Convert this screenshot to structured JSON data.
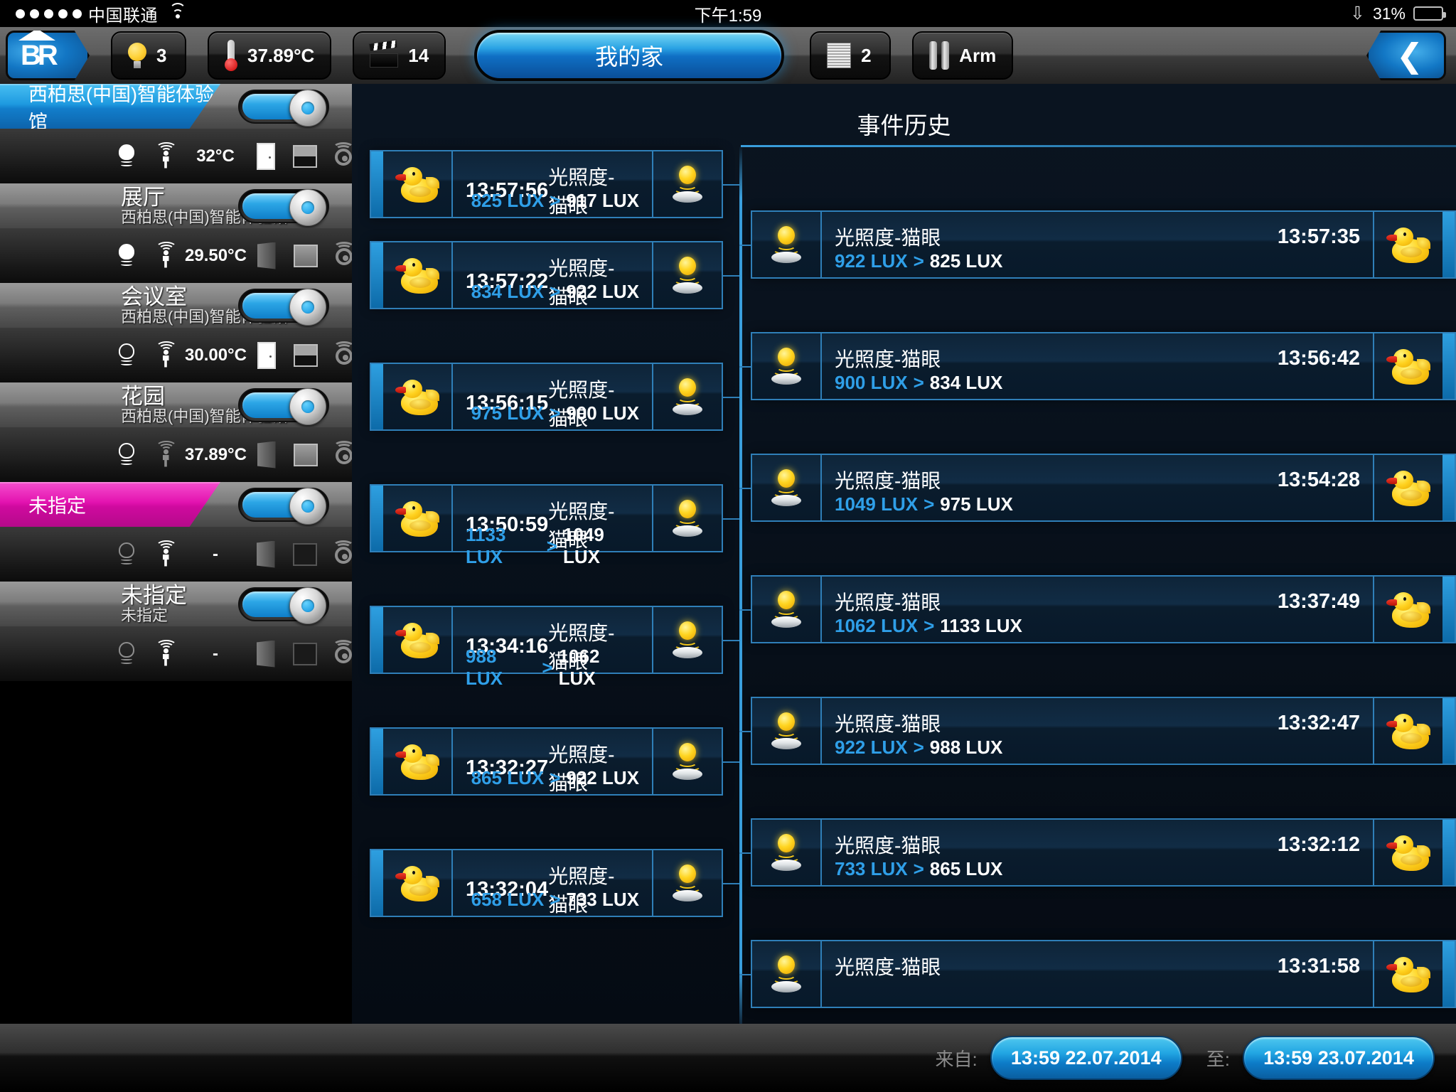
{
  "statusbar": {
    "carrier": "中国联通",
    "time": "下午1:59",
    "battery_percent": "31%",
    "wifi_icon": "wifi-icon",
    "bluetooth_icon": "bluetooth-icon",
    "battery_icon": "battery-icon",
    "signal_dots": 5
  },
  "toolbar": {
    "home_logo": "home-logo-icon",
    "lights": {
      "icon": "light-bulb-icon",
      "count": "3"
    },
    "temperature": {
      "icon": "thermometer-icon",
      "value": "37.89°C"
    },
    "scenes": {
      "icon": "clapperboard-icon",
      "count": "14"
    },
    "blinds": {
      "icon": "blind-icon",
      "count": "2"
    },
    "security": {
      "icon": "arm-icon",
      "label": "Arm"
    },
    "title": "我的家",
    "back_icon": "chevron-left-icon"
  },
  "sidebar": {
    "rooms": [
      {
        "name": "西柏思(中国)智能体验馆",
        "parent": "",
        "accent": "blue",
        "toggle_on": true,
        "thumb": "none",
        "light_state": "on",
        "motion_state": "on",
        "temperature": "32°C",
        "door_state": "closed",
        "blind_state": "half",
        "siren_state": "off"
      },
      {
        "name": "展厅",
        "parent": "西柏思(中国)智能体验馆",
        "accent": "blue",
        "toggle_on": true,
        "thumb": "ball-chair-icon",
        "light_state": "on",
        "motion_state": "on",
        "temperature": "29.50°C",
        "door_state": "open",
        "blind_state": "full",
        "siren_state": "off"
      },
      {
        "name": "会议室",
        "parent": "西柏思(中国)智能体验馆",
        "accent": "blue",
        "toggle_on": true,
        "thumb": "dining-table-icon",
        "light_state": "off",
        "motion_state": "on",
        "temperature": "30.00°C",
        "door_state": "closed",
        "blind_state": "half",
        "siren_state": "off"
      },
      {
        "name": "花园",
        "parent": "西柏思(中国)智能体验馆",
        "accent": "blue",
        "toggle_on": true,
        "thumb": "rubber-duck-icon",
        "light_state": "off",
        "motion_state": "dim",
        "temperature": "37.89°C",
        "door_state": "open",
        "blind_state": "full",
        "siren_state": "off"
      },
      {
        "name": "未指定",
        "parent": "",
        "accent": "pink",
        "toggle_on": true,
        "thumb": "none",
        "light_state": "off",
        "motion_state": "on",
        "temperature": "-",
        "door_state": "open",
        "blind_state": "off",
        "siren_state": "off"
      },
      {
        "name": "未指定",
        "parent": "未指定",
        "accent": "pink",
        "toggle_on": true,
        "thumb": "abc-blocks-icon",
        "light_state": "off",
        "motion_state": "on",
        "temperature": "-",
        "door_state": "open",
        "blind_state": "off",
        "siren_state": "off"
      }
    ]
  },
  "history": {
    "title": "事件历史",
    "device_icon": "rubber-duck-icon",
    "sensor_icon": "light-sensor-icon",
    "events_left": [
      {
        "time": "13:57:56",
        "name": "光照度-猫眼",
        "from": "825 LUX",
        "arrow": ">",
        "to": "917 LUX"
      },
      {
        "time": "13:57:22",
        "name": "光照度-猫眼",
        "from": "834 LUX",
        "arrow": ">",
        "to": "922 LUX"
      },
      {
        "time": "13:56:15",
        "name": "光照度-猫眼",
        "from": "975 LUX",
        "arrow": ">",
        "to": "900 LUX"
      },
      {
        "time": "13:50:59",
        "name": "光照度-猫眼",
        "from": "1133 LUX",
        "arrow": ">",
        "to": "1049 LUX"
      },
      {
        "time": "13:34:16",
        "name": "光照度-猫眼",
        "from": "988 LUX",
        "arrow": ">",
        "to": "1062 LUX"
      },
      {
        "time": "13:32:27",
        "name": "光照度-猫眼",
        "from": "865 LUX",
        "arrow": ">",
        "to": "922 LUX"
      },
      {
        "time": "13:32:04",
        "name": "光照度-猫眼",
        "from": "658 LUX",
        "arrow": ">",
        "to": "733 LUX"
      }
    ],
    "events_right": [
      {
        "name": "光照度-猫眼",
        "time": "13:57:35",
        "from": "922 LUX",
        "arrow": ">",
        "to": "825 LUX"
      },
      {
        "name": "光照度-猫眼",
        "time": "13:56:42",
        "from": "900 LUX",
        "arrow": ">",
        "to": "834 LUX"
      },
      {
        "name": "光照度-猫眼",
        "time": "13:54:28",
        "from": "1049 LUX",
        "arrow": ">",
        "to": "975 LUX"
      },
      {
        "name": "光照度-猫眼",
        "time": "13:37:49",
        "from": "1062 LUX",
        "arrow": ">",
        "to": "1133 LUX"
      },
      {
        "name": "光照度-猫眼",
        "time": "13:32:47",
        "from": "922 LUX",
        "arrow": ">",
        "to": "988 LUX"
      },
      {
        "name": "光照度-猫眼",
        "time": "13:32:12",
        "from": "733 LUX",
        "arrow": ">",
        "to": "865 LUX"
      },
      {
        "name": "光照度-猫眼",
        "time": "13:31:58",
        "from": "",
        "arrow": "",
        "to": ""
      }
    ]
  },
  "bottombar": {
    "from_label": "来自:",
    "from_value": "13:59 22.07.2014",
    "to_label": "至:",
    "to_value": "13:59 23.07.2014"
  },
  "colors": {
    "accent_blue": "#2aa9e8",
    "accent_pink": "#f21bb4",
    "panel_bg": "#0a1420",
    "card_border": "#2f7fb8",
    "lux_from": "#2f9fe8"
  }
}
